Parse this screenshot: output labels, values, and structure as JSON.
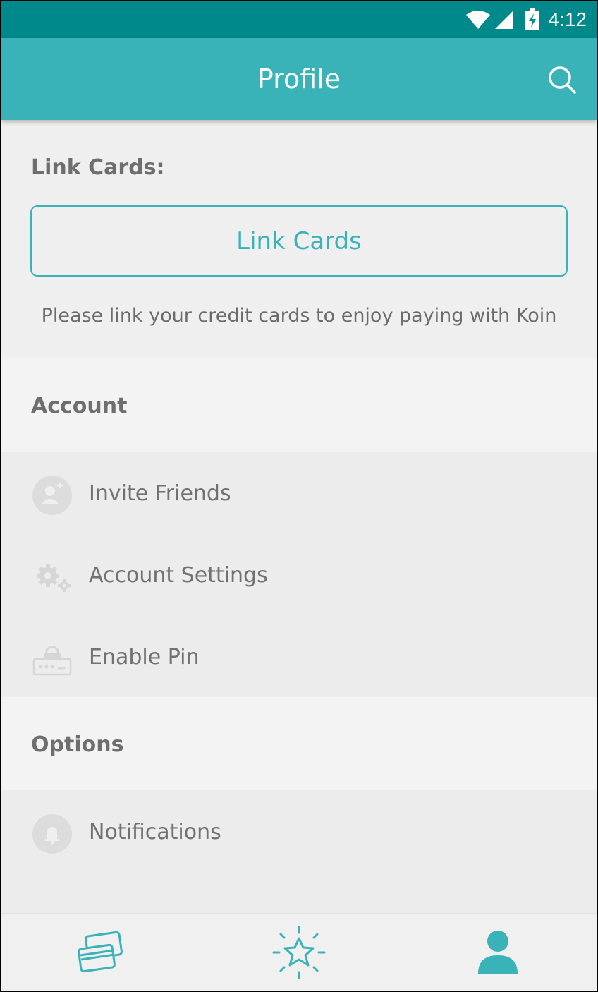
{
  "status_bar": {
    "time": "4:12",
    "icons": [
      "wifi-icon",
      "signal-icon",
      "battery-charging-icon"
    ]
  },
  "app_bar": {
    "title": "Profile",
    "search_icon": "search-icon"
  },
  "link_cards": {
    "section_label": "Link Cards:",
    "button_label": "Link Cards",
    "hint": "Please link your credit cards to enjoy paying with Koin"
  },
  "account": {
    "section_label": "Account",
    "items": [
      {
        "label": "Invite Friends",
        "icon": "add-person-icon"
      },
      {
        "label": "Account Settings",
        "icon": "gears-icon"
      },
      {
        "label": "Enable Pin",
        "icon": "pin-lock-icon"
      }
    ]
  },
  "options": {
    "section_label": "Options",
    "items": [
      {
        "label": "Notifications",
        "icon": "bell-icon"
      }
    ]
  },
  "bottom_nav": {
    "items": [
      {
        "icon": "cards-icon",
        "active": false
      },
      {
        "icon": "star-icon",
        "active": false
      },
      {
        "icon": "profile-icon",
        "active": true
      }
    ]
  },
  "colors": {
    "accent": "#3ab3b8",
    "status_bar": "#00898a",
    "text": "#6e6e6e"
  }
}
